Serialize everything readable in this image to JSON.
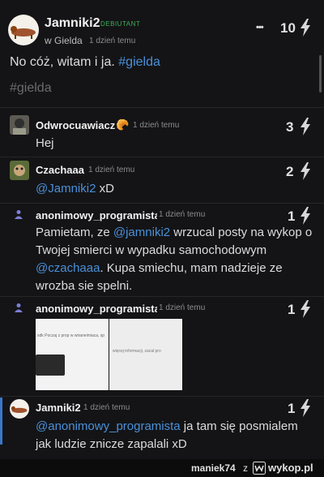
{
  "post": {
    "author": "Jamniki2",
    "badge": "DEBIUTANT",
    "community": "w Gielda",
    "time": "1 dzień temu",
    "score": "10",
    "body_prefix": "No cóż, witam i ja.",
    "body_tag": "#gielda",
    "tag_line": "#gielda",
    "more_label": "•••"
  },
  "comments": [
    {
      "author": "Odwrocuawiacz",
      "time": "1 dzień temu",
      "score": "3",
      "text": "Hej"
    },
    {
      "author": "Czachaaa",
      "time": "1 dzień temu",
      "score": "2",
      "mention": "@Jamniki2",
      "text": " xD"
    },
    {
      "author": "anonimowy_programista",
      "time": "1 dzień temu",
      "score": "1",
      "t1": "Pamietam, ze ",
      "m1": "@jamniki2",
      "t2": " wrzucal posty na wykop o Twojej smierci w wypadku samochodowym ",
      "m2": "@czachaaa",
      "t3": ". Kupa smiechu, mam nadzieje ze wrozba sie spelni."
    },
    {
      "author": "anonimowy_programista",
      "time": "1 dzień temu",
      "score": "1",
      "img1_text": "sdk Poczaj z prop w wiraneimiaca, sp",
      "img2_text": "więcej informacji, zacal pro"
    },
    {
      "author": "Jamniki2",
      "time": "1 dzień temu",
      "score": "1",
      "mention": "@anonimowy_programista",
      "text": " ja tam się posmialem jak ludzie znicze zapalali xD"
    }
  ],
  "footer": {
    "user": "maniek74",
    "z": "z",
    "brand": "wykop.pl"
  },
  "colors": {
    "bg": "#141416",
    "link": "#4a90d9",
    "badge": "#3fae5a"
  }
}
